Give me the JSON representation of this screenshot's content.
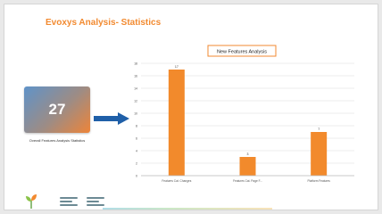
{
  "slide": {
    "title": "Evoxys Analysis- Statistics"
  },
  "kpi": {
    "value": "27",
    "label": "Overall Features Analysis Statistics"
  },
  "colors": {
    "accent": "#f28a30",
    "bar": "#f28a2c",
    "title_border": "#f28a30",
    "arrow": "#1f5fa8"
  },
  "icons": {
    "arrow": "right-arrow-icon",
    "logo": "sprout-logo-icon"
  },
  "chart_data": {
    "type": "bar",
    "title": "New Features Analysis",
    "categories": [
      "Features Cat. Changes",
      "Features Cat. Page F...",
      "Platform Features"
    ],
    "values": [
      17,
      3,
      7
    ],
    "data_labels": [
      "17",
      "3",
      "7"
    ],
    "ylim": [
      0,
      18
    ],
    "yticks": [
      0,
      2,
      4,
      6,
      8,
      10,
      12,
      14,
      16,
      18
    ],
    "grid": true,
    "xlabel": "",
    "ylabel": ""
  }
}
